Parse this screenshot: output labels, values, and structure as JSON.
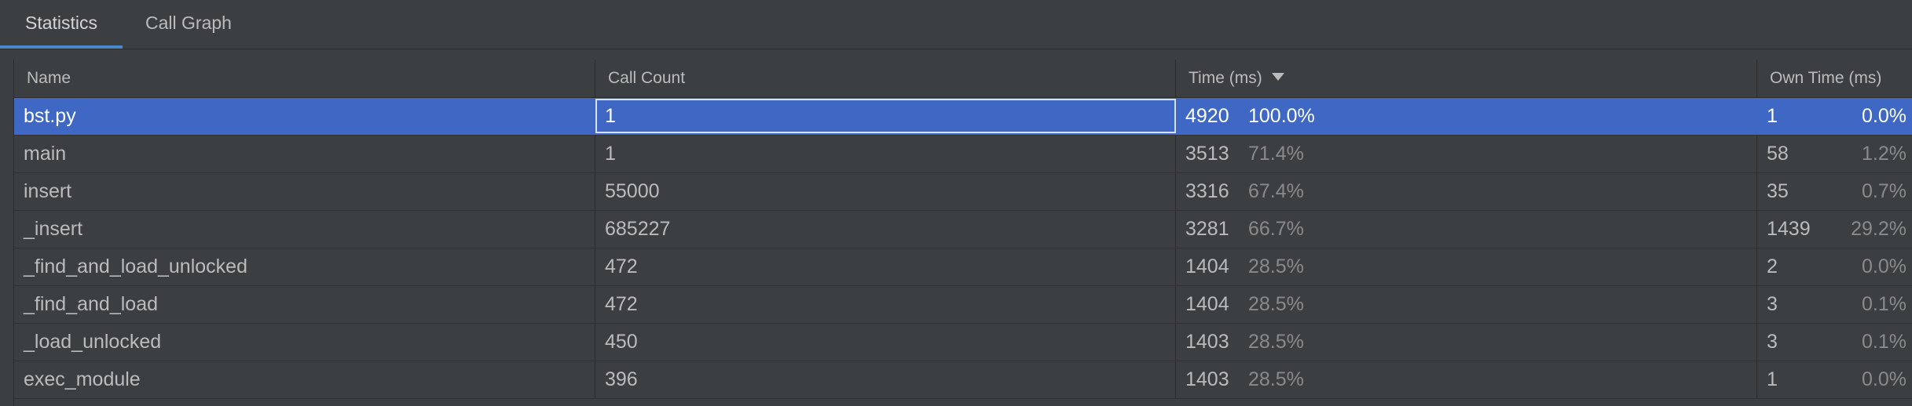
{
  "tabs": [
    {
      "label": "Statistics",
      "active": true
    },
    {
      "label": "Call Graph",
      "active": false
    }
  ],
  "columns": {
    "name": "Name",
    "call_count": "Call Count",
    "time": "Time (ms)",
    "own_time": "Own Time (ms)"
  },
  "sort": {
    "column": "time",
    "direction": "descending",
    "icon": "sort-descending-icon"
  },
  "rows": [
    {
      "name": "bst.py",
      "call_count": "1",
      "time": "4920",
      "time_pct": "100.0%",
      "own_time": "1",
      "own_pct": "0.0%",
      "selected": true
    },
    {
      "name": "main",
      "call_count": "1",
      "time": "3513",
      "time_pct": "71.4%",
      "own_time": "58",
      "own_pct": "1.2%"
    },
    {
      "name": "insert",
      "call_count": "55000",
      "time": "3316",
      "time_pct": "67.4%",
      "own_time": "35",
      "own_pct": "0.7%"
    },
    {
      "name": "_insert",
      "call_count": "685227",
      "time": "3281",
      "time_pct": "66.7%",
      "own_time": "1439",
      "own_pct": "29.2%"
    },
    {
      "name": "_find_and_load_unlocked",
      "call_count": "472",
      "time": "1404",
      "time_pct": "28.5%",
      "own_time": "2",
      "own_pct": "0.0%"
    },
    {
      "name": "_find_and_load",
      "call_count": "472",
      "time": "1404",
      "time_pct": "28.5%",
      "own_time": "3",
      "own_pct": "0.1%"
    },
    {
      "name": "_load_unlocked",
      "call_count": "450",
      "time": "1403",
      "time_pct": "28.5%",
      "own_time": "3",
      "own_pct": "0.1%"
    },
    {
      "name": "exec_module",
      "call_count": "396",
      "time": "1403",
      "time_pct": "28.5%",
      "own_time": "1",
      "own_pct": "0.0%"
    }
  ],
  "colors": {
    "background": "#3c3f41",
    "selection": "#3e68c4",
    "tab_underline": "#4a88c7",
    "text": "#bbbbbb",
    "muted_text": "#8a8a8a"
  }
}
